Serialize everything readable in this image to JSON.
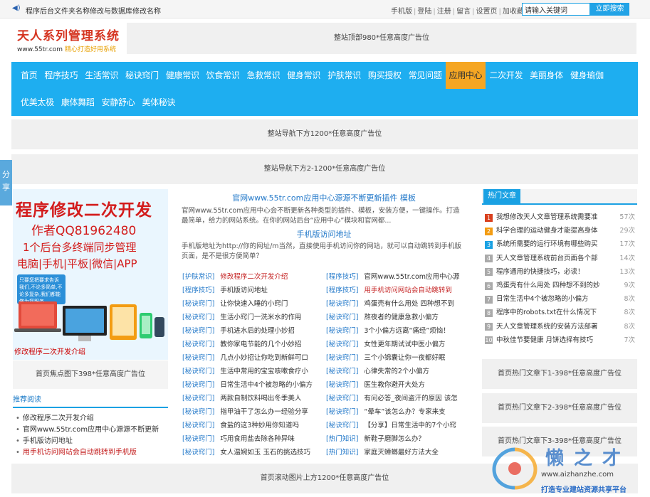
{
  "topbar": {
    "notice_text": "程序后台文件夹名称修改与数据库修改名称",
    "links": [
      "手机版",
      "登陆",
      "注册",
      "留言",
      "设置页",
      "加收藏"
    ],
    "search_placeholder": "请输入关键词",
    "search_button": "立即搜索"
  },
  "logo": {
    "title": "天人系列管理系统",
    "url": "www.55tr.com",
    "slogan": "精心打造好用系统"
  },
  "ads": {
    "top": "整站顶部980*任意高度广告位",
    "nav1": "整站导航下方1200*任意高度广告位",
    "nav2": "整站导航下方2-1200*任意高度广告位",
    "focus_below": "首页焦点图下398*任意高度广告位",
    "hot1": "首页热门文章下1-398*任意高度广告位",
    "hot2": "首页热门文章下2-398*任意高度广告位",
    "hot3": "首页热门文章下3-398*任意高度广告位",
    "bottom": "首页滚动图片上方1200*任意高度广告位"
  },
  "nav": {
    "row1": [
      "首页",
      "程序技巧",
      "生活常识",
      "秘诀窍门",
      "健康常识",
      "饮食常识",
      "急救常识",
      "健身常识",
      "护肤常识",
      "购买授权",
      "常见问题",
      "应用中心",
      "二次开发",
      "美丽身体",
      "健身瑜伽"
    ],
    "row2": [
      "优美太极",
      "康体舞蹈",
      "安静舒心",
      "美体秘诀"
    ],
    "active": "应用中心"
  },
  "share_tab": "分享",
  "promo": {
    "line1": "程序修改二次开发",
    "line2": "作者QQ81962480",
    "line3": "1个后台多终端同步管理",
    "line4": "电脑|手机|平板|微信|APP",
    "bubble": "只要您把要求告诉我们,不论多简单,不论多复杂,我们都能做为您服务",
    "caption": "修改程序二次开发介绍"
  },
  "recommend": {
    "title": "推荐阅读",
    "items": [
      "修改程序二次开发介绍",
      "官网www.55tr.com应用中心源源不断更新",
      "手机版访问地址",
      "用手机访问网站会自动跳转到手机版"
    ]
  },
  "headline": {
    "title1": "官网www.55tr.com应用中心源源不断更新插件 模板",
    "desc1": "官网www.55tr.com应用中心会不断更新各种类型的插件、模板，安装方便，一键操作。打造最简单，给力的网站系统。在你的网站后台“应用中心”模块和官网都...",
    "title2": "手机版访问地址",
    "desc2": "手机版地址为http://你的网址/m当然，直接使用手机访问你的网站，就可以自动跳转到手机版页面，是不是很方便简单？"
  },
  "articles_left": [
    {
      "cat": "[护肤常识]",
      "title": "修改程序二次开发介绍",
      "red": true
    },
    {
      "cat": "[程序技巧]",
      "title": "手机版访问地址",
      "red": false
    },
    {
      "cat": "[秘诀窍门]",
      "title": "让你快速入睡的小窍门",
      "red": false
    },
    {
      "cat": "[秘诀窍门]",
      "title": "生活小窍门一洗米水的作用",
      "red": false
    },
    {
      "cat": "[秘诀窍门]",
      "title": "手机进水后的处理小妙招",
      "red": false
    },
    {
      "cat": "[秘诀窍门]",
      "title": "教你家电节能的几个小妙招",
      "red": false
    },
    {
      "cat": "[秘诀窍门]",
      "title": "几点小妙招让你吃到新鲜可口",
      "red": false
    },
    {
      "cat": "[秘诀窍门]",
      "title": "生活中常用的宝宝咳嗽食疗小",
      "red": false
    },
    {
      "cat": "[秘诀窍门]",
      "title": "日常生活中4个被忽略的小偏方",
      "red": false
    },
    {
      "cat": "[秘诀窍门]",
      "title": "两款自制饮料喝出冬季美人",
      "red": false
    },
    {
      "cat": "[秘诀窍门]",
      "title": "指甲油干了怎么办一经验分享",
      "red": false
    },
    {
      "cat": "[秘诀窍门]",
      "title": "食盐的这3种妙用你知道吗",
      "red": false
    },
    {
      "cat": "[秘诀窍门]",
      "title": "巧用食用盐去除各种异味",
      "red": false
    },
    {
      "cat": "[秘诀窍门]",
      "title": "女人温婉如玉 玉石的挑选技巧",
      "red": false
    }
  ],
  "articles_right": [
    {
      "cat": "[程序技巧]",
      "title": "官网www.55tr.com应用中心源",
      "red": false
    },
    {
      "cat": "[程序技巧]",
      "title": "用手机访问网站会自动跳转到",
      "red": true
    },
    {
      "cat": "[秘诀窍门]",
      "title": "鸡蛋壳有什么用处 四种想不到",
      "red": false
    },
    {
      "cat": "[秘诀窍门]",
      "title": "熬夜者的健康急救小偏方",
      "red": false
    },
    {
      "cat": "[秘诀窍门]",
      "title": "3个小偏方远离“痛经”烦恼！",
      "red": false
    },
    {
      "cat": "[秘诀窍门]",
      "title": "女性更年期试试中医小偏方",
      "red": false
    },
    {
      "cat": "[秘诀窍门]",
      "title": "三个小锦囊让你一夜都好眠",
      "red": false
    },
    {
      "cat": "[秘诀窍门]",
      "title": "心律失常的2个小偏方",
      "red": false
    },
    {
      "cat": "[秘诀窍门]",
      "title": "医生教你避开大处方",
      "red": false
    },
    {
      "cat": "[秘诀窍门]",
      "title": "有问必答_夜间盗汗的原因 该怎",
      "red": false
    },
    {
      "cat": "[秘诀窍门]",
      "title": "“晕车”该怎么办？专家来支",
      "red": false
    },
    {
      "cat": "[秘诀窍门]",
      "title": "【分享】日常生活中的7个小窍",
      "red": false
    },
    {
      "cat": "[热门知识]",
      "title": "新鞋子磨脚怎么办？",
      "red": false
    },
    {
      "cat": "[热门知识]",
      "title": "家庭灭蟑螂最好方法大全",
      "red": false
    }
  ],
  "hot": {
    "title": "热门文章",
    "items": [
      {
        "n": "1",
        "title": "我想修改天人文章管理系统需要准",
        "count": "57次"
      },
      {
        "n": "2",
        "title": "科学合理的运动健身才能提高身体",
        "count": "29次"
      },
      {
        "n": "3",
        "title": "系统所需要的运行环境有哪些购买",
        "count": "17次"
      },
      {
        "n": "4",
        "title": "天人文章管理系统前台页面各个部",
        "count": "14次"
      },
      {
        "n": "5",
        "title": "程序通用的快捷技巧，必读！",
        "count": "13次"
      },
      {
        "n": "6",
        "title": "鸡蛋壳有什么用处 四种想不到的妙",
        "count": "9次"
      },
      {
        "n": "7",
        "title": "日常生活中4个被忽略的小偏方",
        "count": "8次"
      },
      {
        "n": "8",
        "title": "程序中的robots.txt在什么情况下",
        "count": "8次"
      },
      {
        "n": "9",
        "title": "天人文章管理系统的安装方法部署",
        "count": "8次"
      },
      {
        "n": "10",
        "title": "中秋佳节要健康 月饼选择有技巧",
        "count": "7次"
      }
    ]
  },
  "watermark": {
    "brand": "懒之才",
    "url": "www.aizhanzhe.com",
    "slogan": "打造专业建站资源共享平台"
  },
  "colors": {
    "nav_bg": "#1eaef0",
    "nav_active": "#f5a623",
    "link_blue": "#2278c9",
    "red": "#c42020",
    "rank1": "#d9401e",
    "rank2": "#f39c12",
    "rank3": "#1aa1e3",
    "rank_other": "#aaaaaa"
  }
}
